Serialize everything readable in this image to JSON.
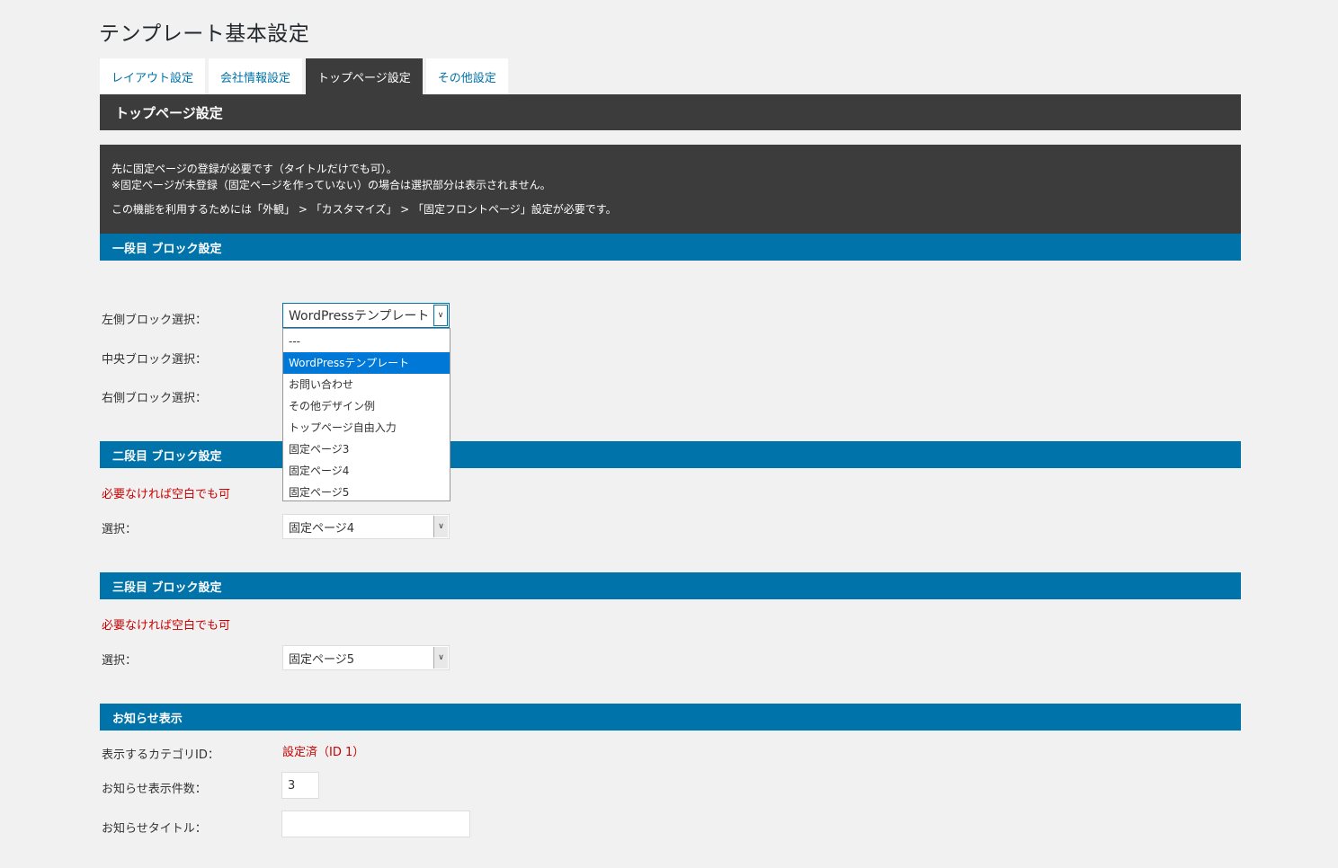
{
  "page_title": "テンプレート基本設定",
  "tabs": [
    {
      "label": "レイアウト設定"
    },
    {
      "label": "会社情報設定"
    },
    {
      "label": "トップページ設定"
    },
    {
      "label": "その他設定"
    }
  ],
  "active_tab": "トップページ設定",
  "section_title": "トップページ設定",
  "notice": {
    "line1": "先に固定ページの登録が必要です（タイトルだけでも可）。",
    "line2": "※固定ページが未登録（固定ページを作っていない）の場合は選択部分は表示されません。",
    "line3": "この機能を利用するためには「外観」 > 「カスタマイズ」 > 「固定フロントページ」設定が必要です。"
  },
  "block1": {
    "title": "一段目 ブロック設定",
    "left_label": "左側ブロック選択：",
    "center_label": "中央ブロック選択：",
    "right_label": "右側ブロック選択：",
    "left_value": "WordPressテンプレート",
    "dropdown_options": [
      "---",
      "WordPressテンプレート",
      "お問い合わせ",
      "その他デザイン例",
      "トップページ自由入力",
      "固定ページ3",
      "固定ページ4",
      "固定ページ5"
    ],
    "dropdown_selected": "WordPressテンプレート"
  },
  "block2": {
    "title": "二段目 ブロック設定",
    "note": "必要なければ空白でも可",
    "select_label": "選択：",
    "select_value": "固定ページ4"
  },
  "block3": {
    "title": "三段目 ブロック設定",
    "note": "必要なければ空白でも可",
    "select_label": "選択：",
    "select_value": "固定ページ5"
  },
  "news": {
    "title": "お知らせ表示",
    "category_label": "表示するカテゴリID：",
    "category_value": "設定済（ID 1）",
    "count_label": "お知らせ表示件数：",
    "count_value": "3",
    "news_title_label": "お知らせタイトル：",
    "news_title_value": ""
  },
  "colors": {
    "accent": "#0073aa",
    "dark": "#3c3c3c",
    "warning": "#cc0000",
    "selected_option": "#0078d7"
  },
  "icons": {
    "select_arrow": "chevron-down-icon"
  }
}
